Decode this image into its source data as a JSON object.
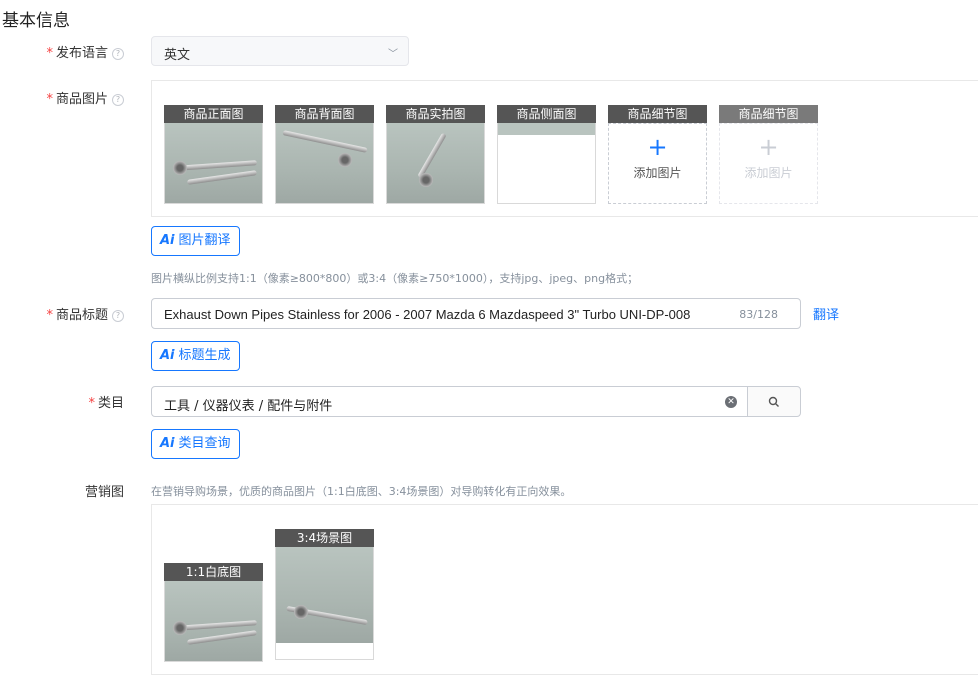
{
  "section_title": "基本信息",
  "language": {
    "label": "发布语言",
    "value": "英文"
  },
  "images": {
    "label": "商品图片",
    "slots": [
      {
        "caption": "商品正面图"
      },
      {
        "caption": "商品背面图"
      },
      {
        "caption": "商品实拍图"
      },
      {
        "caption": "商品侧面图"
      },
      {
        "caption": "商品细节图",
        "add_text": "添加图片"
      },
      {
        "caption": "商品细节图",
        "add_text": "添加图片"
      }
    ],
    "ai_button": "图片翻译",
    "hint": "图片横纵比例支持1:1（像素≥800*800）或3:4（像素≥750*1000），支持jpg、jpeg、png格式；"
  },
  "title": {
    "label": "商品标题",
    "value": "Exhaust Down Pipes Stainless for 2006 - 2007 Mazda 6 Mazdaspeed 3\" Turbo UNI-DP-008",
    "count": "83/128",
    "translate_link": "翻译",
    "ai_button": "标题生成"
  },
  "category": {
    "label": "类目",
    "value": "工具 / 仪器仪表 / 配件与附件",
    "ai_button": "类目查询"
  },
  "marketing": {
    "label": "营销图",
    "hint": "在营销导购场景，优质的商品图片（1:1白底图、3:4场景图）对导购转化有正向效果。",
    "slots": [
      {
        "caption": "1:1白底图"
      },
      {
        "caption": "3:4场景图"
      }
    ]
  },
  "ai_badge": "Ai",
  "colors": {
    "accent": "#1677ff",
    "required": "#f53f3f",
    "caption_bg": "#555555"
  }
}
